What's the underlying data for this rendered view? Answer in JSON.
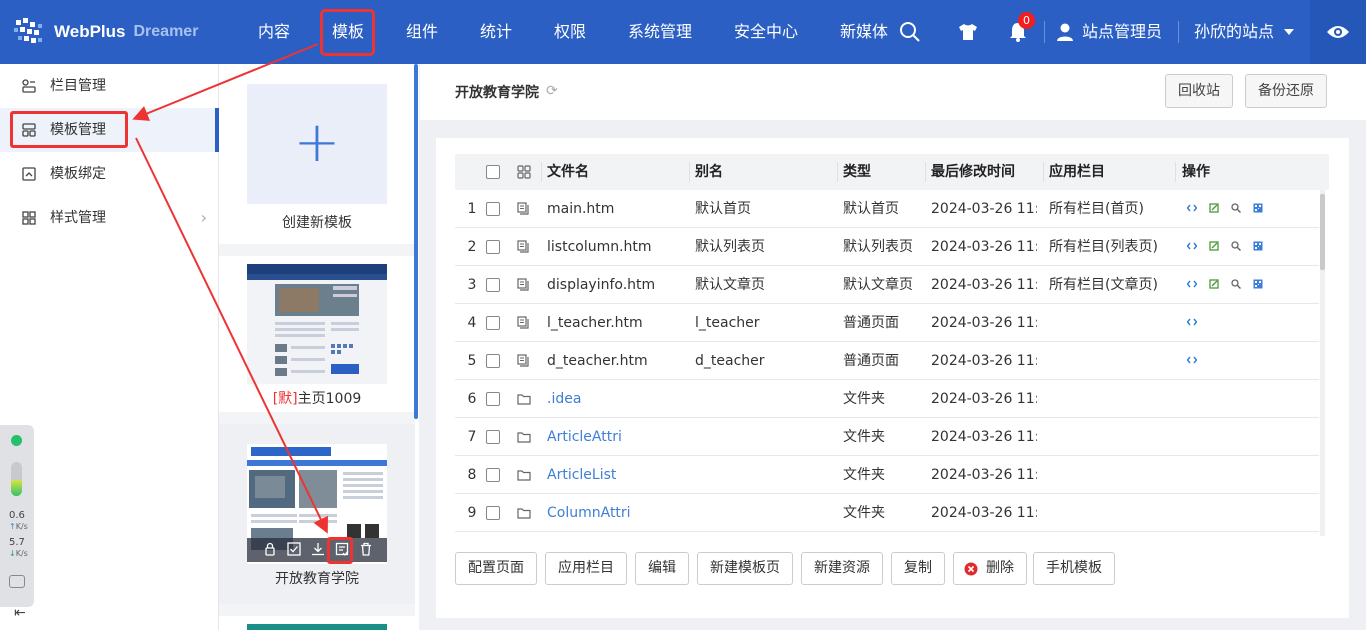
{
  "brand": {
    "name": "WebPlus",
    "sub": "Dreamer"
  },
  "nav": {
    "items": [
      "内容",
      "模板",
      "组件",
      "统计",
      "权限",
      "系统管理",
      "安全中心",
      "新媒体"
    ],
    "active": "模板"
  },
  "topbar": {
    "notification_count": "0",
    "user": "站点管理员",
    "site": "孙欣的站点"
  },
  "sidebar": {
    "items": [
      {
        "label": "栏目管理"
      },
      {
        "label": "模板管理"
      },
      {
        "label": "模板绑定"
      },
      {
        "label": "样式管理"
      }
    ],
    "active": "模板管理"
  },
  "templates": {
    "create_label": "创建新模板",
    "default_mark": "[默]",
    "card1": "主页1009",
    "card2": "开放教育学院"
  },
  "header": {
    "title": "开放教育学院",
    "recycle": "回收站",
    "backup": "备份还原"
  },
  "table": {
    "columns": [
      "文件名",
      "别名",
      "类型",
      "最后修改时间",
      "应用栏目",
      "操作"
    ],
    "rows": [
      {
        "n": "1",
        "file": "main.htm",
        "alias": "默认首页",
        "type": "默认首页",
        "time": "2024-03-26 11:...",
        "apply": "所有栏目(首页)",
        "kind": "page",
        "ops": 4
      },
      {
        "n": "2",
        "file": "listcolumn.htm",
        "alias": "默认列表页",
        "type": "默认列表页",
        "time": "2024-03-26 11:...",
        "apply": "所有栏目(列表页)",
        "kind": "page",
        "ops": 4
      },
      {
        "n": "3",
        "file": "displayinfo.htm",
        "alias": "默认文章页",
        "type": "默认文章页",
        "time": "2024-03-26 11:...",
        "apply": "所有栏目(文章页)",
        "kind": "page",
        "ops": 4
      },
      {
        "n": "4",
        "file": "l_teacher.htm",
        "alias": "l_teacher",
        "type": "普通页面",
        "time": "2024-03-26 11:...",
        "apply": "",
        "kind": "page",
        "ops": 1
      },
      {
        "n": "5",
        "file": "d_teacher.htm",
        "alias": "d_teacher",
        "type": "普通页面",
        "time": "2024-03-26 11:...",
        "apply": "",
        "kind": "page",
        "ops": 1
      },
      {
        "n": "6",
        "file": ".idea",
        "alias": "",
        "type": "文件夹",
        "time": "2024-03-26 11:...",
        "apply": "",
        "kind": "folder",
        "ops": 0
      },
      {
        "n": "7",
        "file": "ArticleAttri",
        "alias": "",
        "type": "文件夹",
        "time": "2024-03-26 11:...",
        "apply": "",
        "kind": "folder",
        "ops": 0
      },
      {
        "n": "8",
        "file": "ArticleList",
        "alias": "",
        "type": "文件夹",
        "time": "2024-03-26 11:...",
        "apply": "",
        "kind": "folder",
        "ops": 0
      },
      {
        "n": "9",
        "file": "ColumnAttri",
        "alias": "",
        "type": "文件夹",
        "time": "2024-03-26 11:...",
        "apply": "",
        "kind": "folder",
        "ops": 0
      }
    ]
  },
  "actions": [
    "配置页面",
    "应用栏目",
    "编辑",
    "新建模板页",
    "新建资源",
    "复制",
    "删除",
    "手机模板"
  ],
  "widget": {
    "up": "0.6",
    "down": "5.7",
    "unit": "K/s"
  },
  "colors": {
    "primary": "#2b5fc3",
    "highlight": "#e33333",
    "link": "#3d7fd6"
  }
}
